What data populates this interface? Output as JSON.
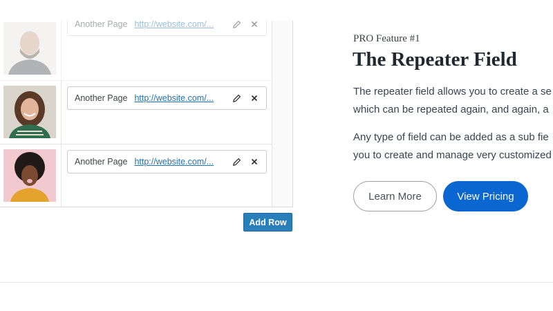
{
  "repeater": {
    "rows": [
      {
        "title": "Another Page",
        "url": "http://website.com/...",
        "avatar": "person-1-avatar"
      },
      {
        "title": "Another Page",
        "url": "http://website.com/...",
        "avatar": "person-2-avatar"
      },
      {
        "title": "Another Page",
        "url": "http://website.com/...",
        "avatar": "person-3-avatar"
      }
    ],
    "add_row_label": "Add Row",
    "icons": {
      "edit": "pencil-icon",
      "remove": "close-icon"
    }
  },
  "feature": {
    "kicker": "PRO Feature #1",
    "title": "The Repeater Field",
    "para1_line1": "The repeater field allows you to create a se",
    "para1_line2": "which can be repeated again, and again, a",
    "para2_line1": "Any type of field can be added as a sub fie",
    "para2_line2": "you to create and manage very customized"
  },
  "buttons": {
    "learn_more": "Learn More",
    "view_pricing": "View Pricing"
  },
  "colors": {
    "primary_blue": "#0a66d1",
    "add_row_blue": "#2a7fba",
    "link_blue": "#2271b1"
  }
}
